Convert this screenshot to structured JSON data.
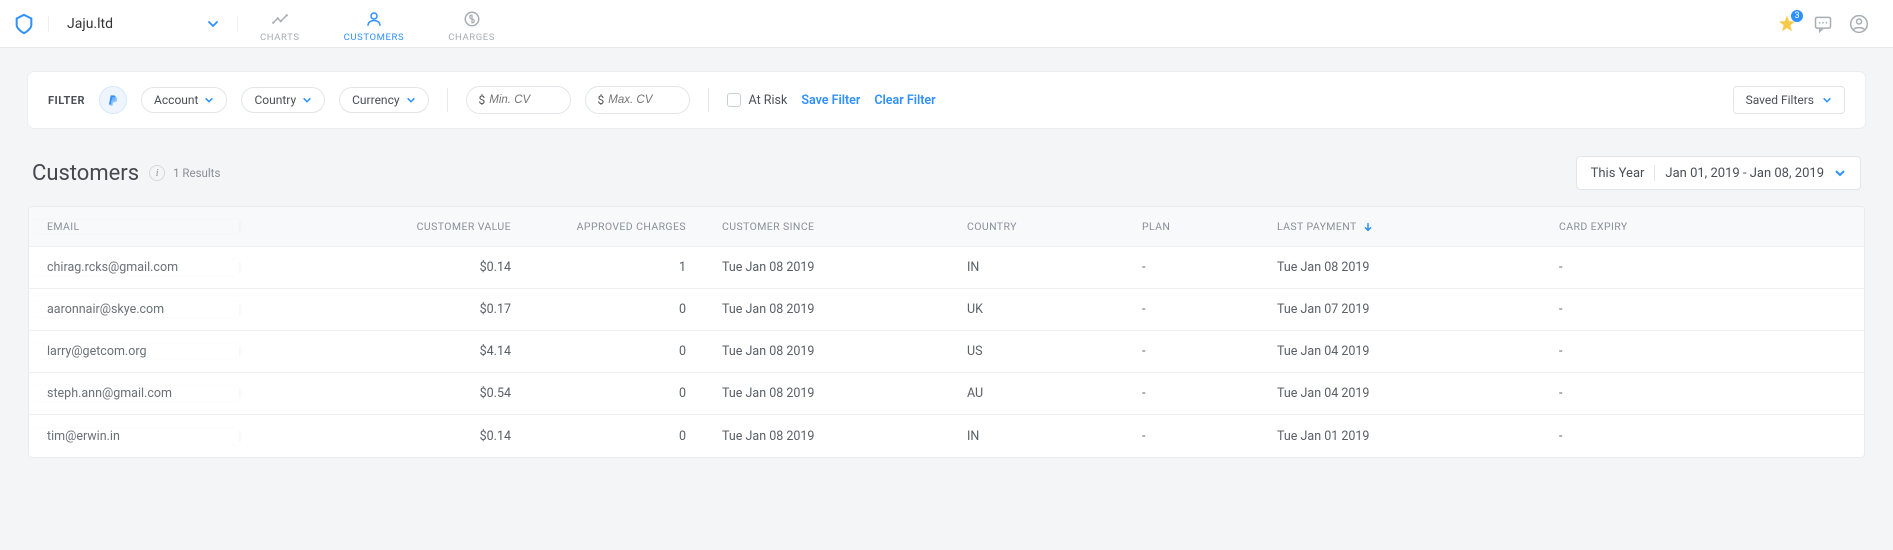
{
  "header": {
    "site_name": "Jaju.ltd",
    "nav": {
      "charts": "CHARTS",
      "customers": "CUSTOMERS",
      "charges": "CHARGES"
    },
    "star_badge": "3"
  },
  "filter": {
    "label": "FILTER",
    "account": "Account",
    "country": "Country",
    "currency": "Currency",
    "min_cv_placeholder": "Min. CV",
    "max_cv_placeholder": "Max. CV",
    "at_risk": "At Risk",
    "save_filter": "Save Filter",
    "clear_filter": "Clear Filter",
    "saved_filters": "Saved Filters"
  },
  "page": {
    "title": "Customers",
    "results": "1 Results",
    "range_label": "This Year",
    "range_value": "Jan 01, 2019 - Jan 08, 2019"
  },
  "table": {
    "headers": {
      "email": "EMAIL",
      "value": "CUSTOMER VALUE",
      "approved": "APPROVED CHARGES",
      "since": "CUSTOMER SINCE",
      "country": "COUNTRY",
      "plan": "PLAN",
      "last_payment": "LAST PAYMENT",
      "card_expiry": "CARD EXPIRY"
    },
    "rows": [
      {
        "email": "chirag.rcks@gmail.com",
        "value": "$0.14",
        "approved": "1",
        "since": "Tue Jan 08 2019",
        "country": "IN",
        "plan": "-",
        "last_payment": "Tue Jan 08 2019",
        "card_expiry": "-"
      },
      {
        "email": "aaronnair@skye.com",
        "value": "$0.17",
        "approved": "0",
        "since": "Tue Jan 08 2019",
        "country": "UK",
        "plan": "-",
        "last_payment": "Tue Jan 07 2019",
        "card_expiry": "-"
      },
      {
        "email": "larry@getcom.org",
        "value": "$4.14",
        "approved": "0",
        "since": "Tue Jan 08 2019",
        "country": "US",
        "plan": "-",
        "last_payment": "Tue Jan 04 2019",
        "card_expiry": "-"
      },
      {
        "email": "steph.ann@gmail.com",
        "value": "$0.54",
        "approved": "0",
        "since": "Tue Jan 08 2019",
        "country": "AU",
        "plan": "-",
        "last_payment": "Tue Jan 04 2019",
        "card_expiry": "-"
      },
      {
        "email": "tim@erwin.in",
        "value": "$0.14",
        "approved": "0",
        "since": "Tue Jan 08 2019",
        "country": "IN",
        "plan": "-",
        "last_payment": "Tue Jan 01 2019",
        "card_expiry": "-"
      }
    ]
  }
}
